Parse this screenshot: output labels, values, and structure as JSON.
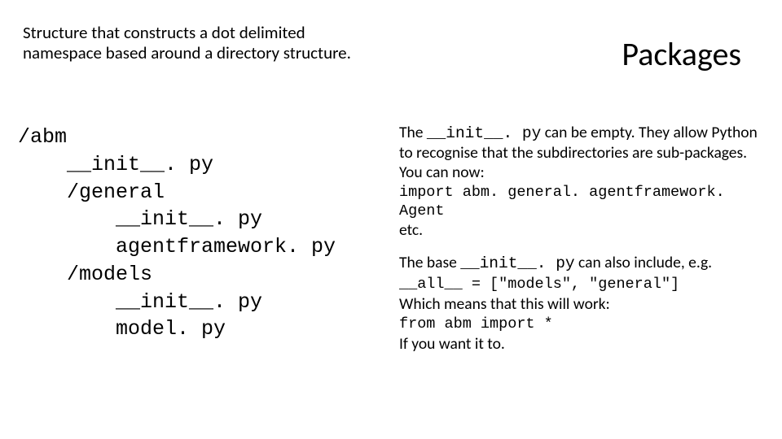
{
  "header": {
    "subtitle": "Structure that constructs a dot delimited namespace based around a directory structure.",
    "title": "Packages"
  },
  "tree": "/abm\n    __init__. py\n    /general\n        __init__. py\n        agentframework. py\n    /models\n        __init__. py\n        model. py",
  "right": {
    "p1_pre": "The ",
    "p1_code": "__init__. py",
    "p1_post": " can be empty. They allow Python to recognise that the subdirectories are sub-packages. You can now:",
    "import_line": "import abm. general. agentframework. Agent",
    "etc": "etc.",
    "p2_pre": "The base ",
    "p2_code": "__init__. py",
    "p2_post": " can also include, e.g.",
    "all_line": "__all__ = [\"models\", \"general\"]",
    "p3": "Which means that this will work:",
    "from_line": "from abm import *",
    "p4": "If you want it to."
  }
}
